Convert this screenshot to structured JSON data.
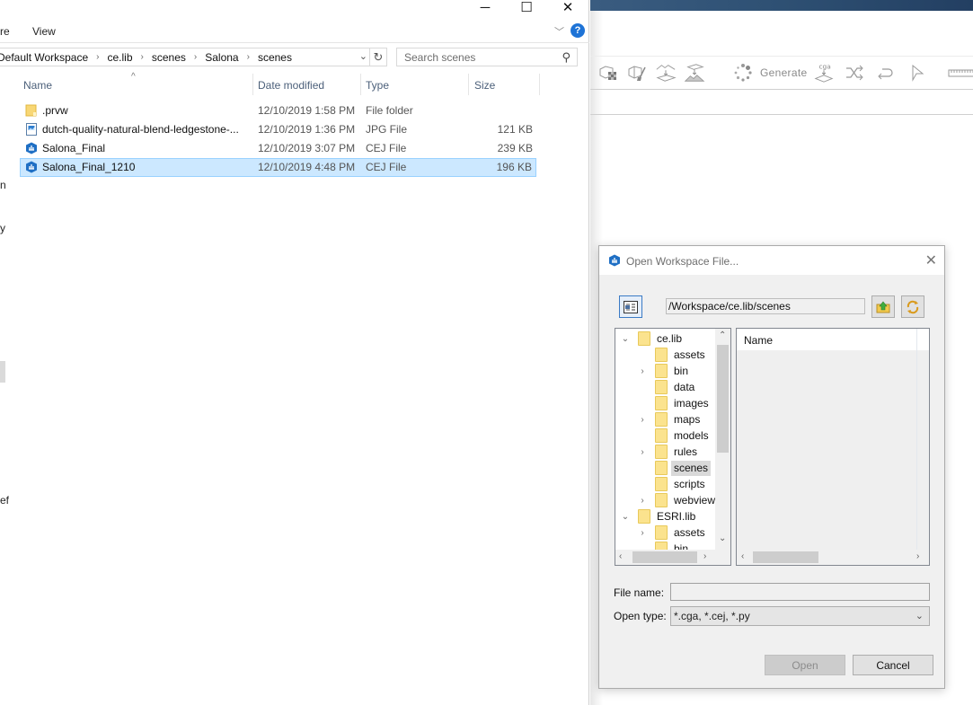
{
  "explorer": {
    "window_controls": {
      "minimize": "─",
      "maximize": "☐",
      "close": "✕"
    },
    "ribbon_tabs": [
      "re",
      "View"
    ],
    "breadcrumb": [
      "Default Workspace",
      "ce.lib",
      "scenes",
      "Salona",
      "scenes"
    ],
    "search_placeholder": "Search scenes",
    "columns": {
      "name": "Name",
      "date": "Date modified",
      "type": "Type",
      "size": "Size"
    },
    "files": [
      {
        "name": ".prvw",
        "date": "12/10/2019 1:58 PM",
        "type": "File folder",
        "size": "",
        "icon": "folder-icon",
        "selected": false
      },
      {
        "name": "dutch-quality-natural-blend-ledgestone-...",
        "date": "12/10/2019 1:36 PM",
        "type": "JPG File",
        "size": "121 KB",
        "icon": "image-file-icon",
        "selected": false
      },
      {
        "name": "Salona_Final",
        "date": "12/10/2019 3:07 PM",
        "type": "CEJ File",
        "size": "239 KB",
        "icon": "cityengine-file-icon",
        "selected": false
      },
      {
        "name": "Salona_Final_1210",
        "date": "12/10/2019 4:48 PM",
        "type": "CEJ File",
        "size": "196 KB",
        "icon": "cityengine-file-icon",
        "selected": true
      }
    ],
    "clipped_nav_text": [
      "n",
      "y",
      "ef"
    ]
  },
  "app": {
    "toolbar": {
      "generate_label": "Generate",
      "cga_label": "cga"
    }
  },
  "dialog": {
    "title": "Open Workspace File...",
    "path": "/Workspace/ce.lib/scenes",
    "tree": [
      {
        "label": "ce.lib",
        "level": 0,
        "twisty": "expanded"
      },
      {
        "label": "assets",
        "level": 1,
        "twisty": "none"
      },
      {
        "label": "bin",
        "level": 1,
        "twisty": "collapsed"
      },
      {
        "label": "data",
        "level": 1,
        "twisty": "none"
      },
      {
        "label": "images",
        "level": 1,
        "twisty": "none"
      },
      {
        "label": "maps",
        "level": 1,
        "twisty": "collapsed"
      },
      {
        "label": "models",
        "level": 1,
        "twisty": "none"
      },
      {
        "label": "rules",
        "level": 1,
        "twisty": "collapsed"
      },
      {
        "label": "scenes",
        "level": 1,
        "twisty": "none",
        "selected": true
      },
      {
        "label": "scripts",
        "level": 1,
        "twisty": "none"
      },
      {
        "label": "webviewer",
        "level": 1,
        "twisty": "collapsed"
      },
      {
        "label": "ESRI.lib",
        "level": 0,
        "twisty": "expanded"
      },
      {
        "label": "assets",
        "level": 1,
        "twisty": "collapsed"
      },
      {
        "label": "bin",
        "level": 1,
        "twisty": "none"
      }
    ],
    "list_header": "Name",
    "file_name_label": "File name:",
    "file_name_value": "",
    "open_type_label": "Open type:",
    "open_type_value": "*.cga, *.cej, *.py",
    "open_button": "Open",
    "cancel_button": "Cancel",
    "open_enabled": false
  }
}
